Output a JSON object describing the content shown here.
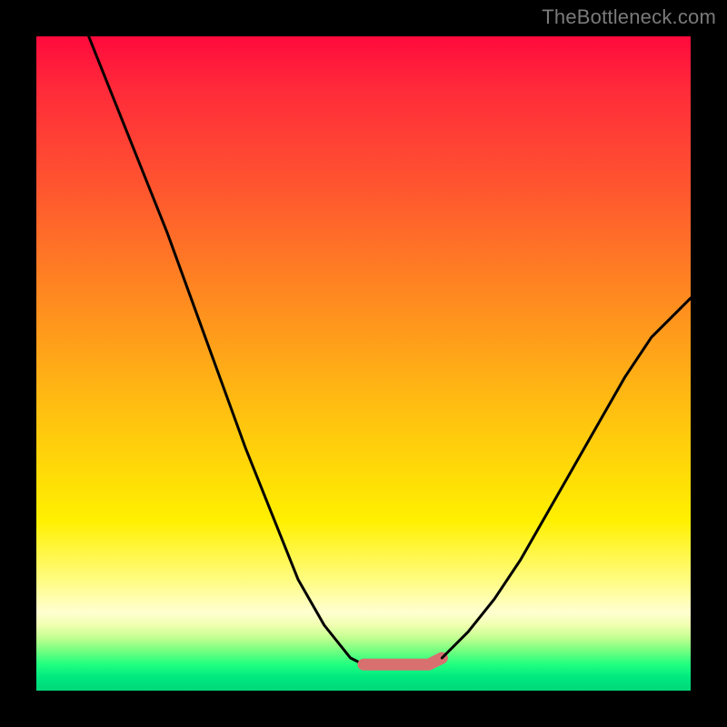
{
  "watermark": "TheBottleneck.com",
  "chart_data": {
    "type": "line",
    "title": "",
    "xlabel": "",
    "ylabel": "",
    "xlim": [
      0,
      100
    ],
    "ylim": [
      0,
      100
    ],
    "grid": false,
    "legend": false,
    "series": [
      {
        "name": "curve-left",
        "color": "#000000",
        "x": [
          8,
          12,
          16,
          20,
          24,
          28,
          32,
          36,
          40,
          44,
          48,
          50,
          52
        ],
        "values": [
          100,
          90,
          80,
          70,
          59,
          48,
          37,
          27,
          17,
          10,
          5,
          4,
          4
        ]
      },
      {
        "name": "flat-bottom",
        "color": "#d97070",
        "x": [
          50,
          52,
          54,
          56,
          58,
          60,
          62
        ],
        "values": [
          4,
          4,
          4,
          4,
          4,
          4,
          5
        ]
      },
      {
        "name": "curve-right",
        "color": "#000000",
        "x": [
          62,
          66,
          70,
          74,
          78,
          82,
          86,
          90,
          94,
          98,
          100
        ],
        "values": [
          5,
          9,
          14,
          20,
          27,
          34,
          41,
          48,
          54,
          58,
          60
        ]
      }
    ],
    "annotations": [
      {
        "text": "TheBottleneck.com",
        "position": "top-right"
      }
    ]
  },
  "colors": {
    "frame_background": "#000000",
    "curve_main": "#000000",
    "curve_highlight": "#d97070",
    "watermark_text": "#7a7a7a"
  }
}
